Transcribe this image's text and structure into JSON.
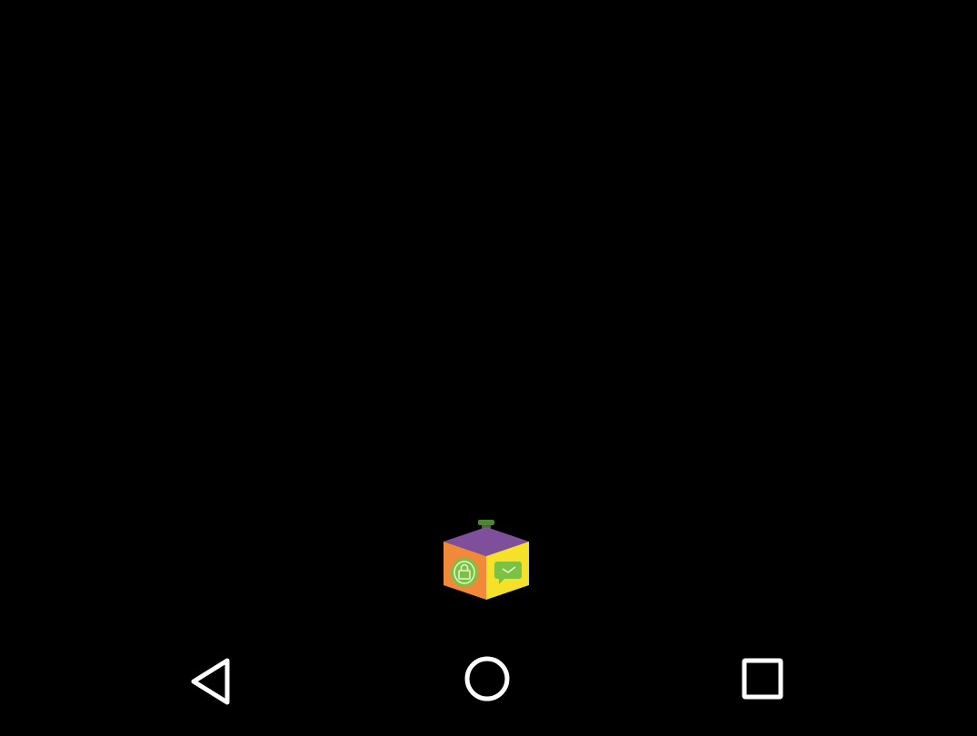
{
  "screen": {
    "background": "#000000"
  },
  "launcher_icon": {
    "icon": "app-lock-cube-icon",
    "colors": {
      "top": "#7e4f9a",
      "left": "#f08a3a",
      "right": "#f5e02a",
      "lock": "#7cc242",
      "handle": "#3f6e2c"
    }
  },
  "nav_bar": {
    "icon_color": "#ffffff",
    "back": {
      "icon": "back-triangle-icon"
    },
    "home": {
      "icon": "home-circle-icon"
    },
    "recents": {
      "icon": "recents-square-icon"
    }
  }
}
